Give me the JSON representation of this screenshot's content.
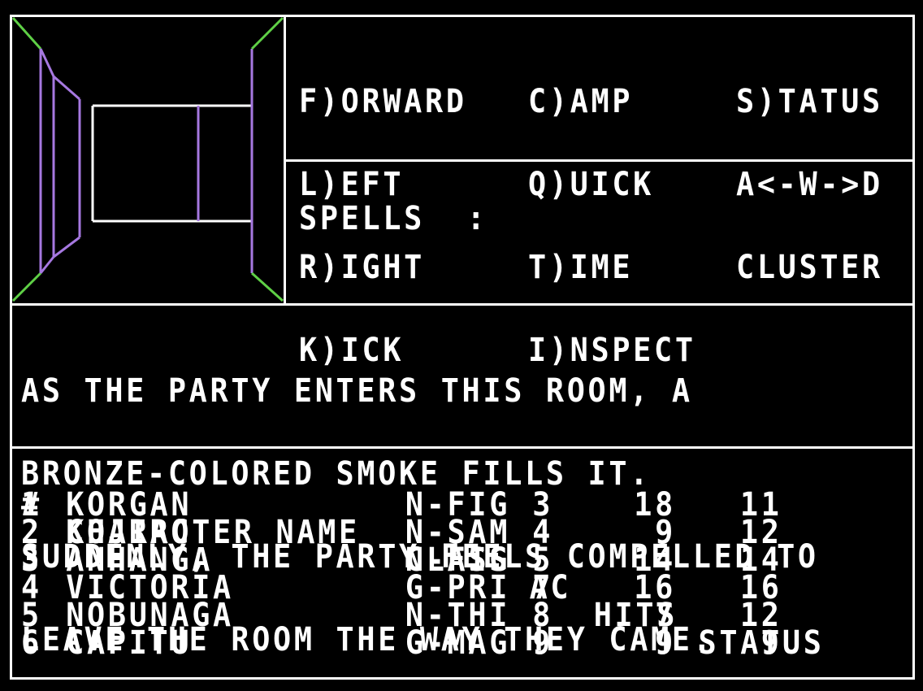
{
  "menu": {
    "col1": [
      "F)ORWARD",
      "L)EFT",
      "R)IGHT",
      "K)ICK"
    ],
    "col2": [
      "C)AMP",
      "Q)UICK",
      "T)IME",
      "I)NSPECT"
    ],
    "col3": [
      "S)TATUS",
      "A<-W->D",
      "CLUSTER"
    ]
  },
  "spells_label": "SPELLS  :",
  "message": [
    "AS THE PARTY ENTERS THIS ROOM, A",
    "BRONZE-COLORED SMOKE FILLS IT.",
    "SUDDENLY, THE PARTY FEELS COMPELLED TO",
    "LEAVE THE ROOM THE WAY THEY CAME."
  ],
  "party_header": {
    "num": "#",
    "name": "CHARACTER NAME",
    "class": "CLASS",
    "ac": "AC",
    "hits": "HITS",
    "status": "STATUS"
  },
  "party": [
    {
      "num": "1",
      "name": "KORGAN",
      "class": "N-FIG",
      "ac": "3",
      "hits": "18",
      "status": "11"
    },
    {
      "num": "2",
      "name": "KOJIRO",
      "class": "N-SAM",
      "ac": "4",
      "hits": "9",
      "status": "12"
    },
    {
      "num": "3",
      "name": "ANHANGA",
      "class": "N-FIG",
      "ac": "5",
      "hits": "14",
      "status": "14"
    },
    {
      "num": "4",
      "name": "VICTORIA",
      "class": "G-PRI",
      "ac": "7",
      "hits": "16",
      "status": "16"
    },
    {
      "num": "5",
      "name": "NOBUNAGA",
      "class": "N-THI",
      "ac": "8",
      "hits": "7",
      "status": "12"
    },
    {
      "num": "6",
      "name": "CAPITU",
      "class": "G-MAG",
      "ac": "9",
      "hits": "9",
      "status": "9"
    }
  ],
  "colors": {
    "border": "#ffffff",
    "green": "#5fd046",
    "purple": "#a678e0",
    "background": "#000000"
  }
}
